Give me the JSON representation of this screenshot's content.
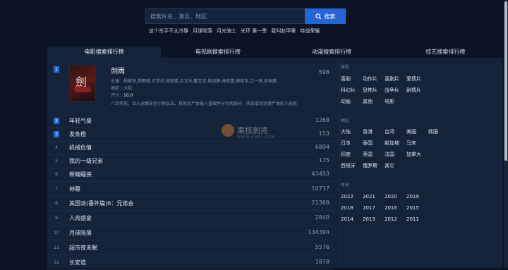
{
  "search": {
    "placeholder": "搜索片名、演员、地区",
    "button_label": "搜索"
  },
  "hot_searches": [
    "这个杀手不太冷静",
    "月球陨落",
    "月光骑士",
    "光环 第一季",
    "我叫赵甲第",
    "特战荣耀"
  ],
  "tabs": [
    "电影搜索排行榜",
    "电视剧搜索排行榜",
    "动漫搜索排行榜",
    "综艺搜索排行榜"
  ],
  "first": {
    "rank": "1",
    "title": "剑雨",
    "count": "598",
    "cast": "主演：杨紫琼,郑雨盛,王学圻,徐熙娣,余文乐,戴立忍,陈凯静,林熙蕾,郭晓东,江一燕,吴佩慈",
    "region": "地区：大陆",
    "score_label": "评分：",
    "score": "10.0",
    "desc": "八百年前，旦入达摩来至中原弘法，其死后尸体被人盗取并分为两部分，传说拿到达摩尸体的人能练",
    "poster_glyph": "劍"
  },
  "rows": [
    {
      "rank": "2",
      "name": "年轻气盛",
      "count": "1268"
    },
    {
      "rank": "3",
      "name": "发条橙",
      "count": "153"
    },
    {
      "rank": "4",
      "name": "机械危情",
      "count": "6804"
    },
    {
      "rank": "5",
      "name": "我的一级兄弟",
      "count": "175"
    },
    {
      "rank": "6",
      "name": "新蝙蝠侠",
      "count": "43453"
    },
    {
      "rank": "7",
      "name": "神幕",
      "count": "10717"
    },
    {
      "rank": "8",
      "name": "美国派(番外篇)6：兄弟会",
      "count": "21369"
    },
    {
      "rank": "9",
      "name": "人肉盛宴",
      "count": "2840"
    },
    {
      "rank": "10",
      "name": "月球陨落",
      "count": "134394"
    },
    {
      "rank": "11",
      "name": "超市夜未眠",
      "count": "5576"
    },
    {
      "rank": "12",
      "name": "长安道",
      "count": "1878"
    }
  ],
  "filters": {
    "type_title": "类型",
    "types": [
      "喜剧",
      "动作片",
      "喜剧片",
      "爱情片",
      "科幻片",
      "恐怖片",
      "战争片",
      "剧情片",
      "动画",
      "其他",
      "电影"
    ],
    "region_title": "地区",
    "regions": [
      "大陆",
      "香港",
      "台湾",
      "美国",
      "韩国",
      "日本",
      "泰国",
      "新加坡",
      "马来",
      "印度",
      "英国",
      "法国",
      "加拿大",
      "西班牙",
      "俄罗斯",
      "其它"
    ],
    "year_title": "年代",
    "years": [
      "2022",
      "2021",
      "2020",
      "2019",
      "2018",
      "2017",
      "2016",
      "2015",
      "2014",
      "2013",
      "2012",
      "2011"
    ]
  },
  "watermark": {
    "text": "果核剥壳",
    "sub": "WWW.GHXI.COM"
  }
}
